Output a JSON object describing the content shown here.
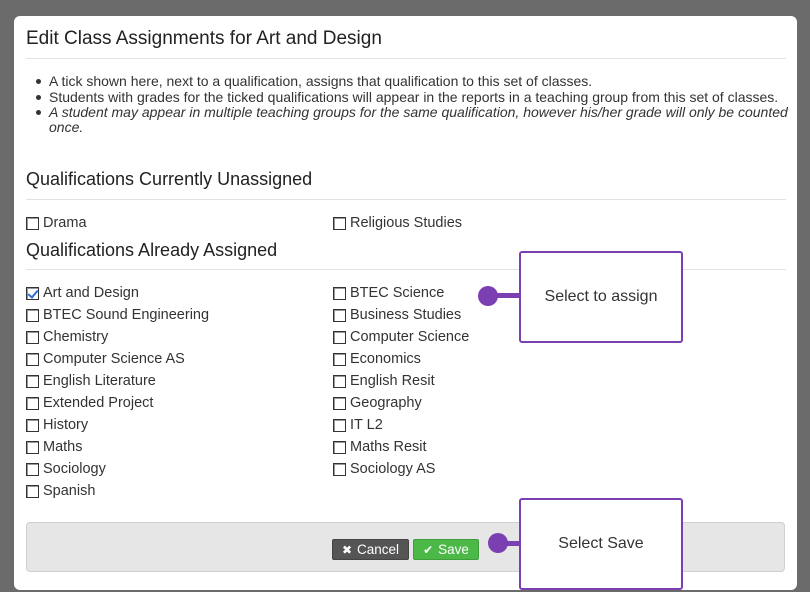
{
  "modal": {
    "title": "Edit Class Assignments for Art and Design",
    "notes": [
      "A tick shown here, next to a qualification, assigns that qualification to this set of classes.",
      "Students with grades for the ticked qualifications will appear in the reports in a teaching group from this set of classes.",
      "A student may appear in multiple teaching groups for the same qualification, however his/her grade will only be counted once."
    ]
  },
  "unassigned": {
    "heading": "Qualifications Currently Unassigned",
    "items": [
      {
        "label": "Drama",
        "checked": false
      },
      {
        "label": "Religious Studies",
        "checked": false
      }
    ]
  },
  "assigned": {
    "heading": "Qualifications Already Assigned",
    "items": [
      {
        "label": "Art and Design",
        "checked": true
      },
      {
        "label": "BTEC Science",
        "checked": false
      },
      {
        "label": "BTEC Sound Engineering",
        "checked": false
      },
      {
        "label": "Business Studies",
        "checked": false
      },
      {
        "label": "Chemistry",
        "checked": false
      },
      {
        "label": "Computer Science",
        "checked": false
      },
      {
        "label": "Computer Science AS",
        "checked": false
      },
      {
        "label": "Economics",
        "checked": false
      },
      {
        "label": "English Literature",
        "checked": false
      },
      {
        "label": "English Resit",
        "checked": false
      },
      {
        "label": "Extended Project",
        "checked": false
      },
      {
        "label": "Geography",
        "checked": false
      },
      {
        "label": "History",
        "checked": false
      },
      {
        "label": "IT L2",
        "checked": false
      },
      {
        "label": "Maths",
        "checked": false
      },
      {
        "label": "Maths Resit",
        "checked": false
      },
      {
        "label": "Sociology",
        "checked": false
      },
      {
        "label": "Sociology AS",
        "checked": false
      },
      {
        "label": "Spanish",
        "checked": false
      }
    ]
  },
  "footer": {
    "cancel_label": "Cancel",
    "cancel_icon": "close-icon",
    "save_label": "Save",
    "save_icon": "check-icon"
  },
  "callouts": {
    "assign": "Select to assign",
    "save": "Select Save",
    "color": "#7a3fb0"
  },
  "colors": {
    "save_button": "#4cb848",
    "cancel_button": "#555555",
    "checkmark": "#2a6fd6"
  }
}
